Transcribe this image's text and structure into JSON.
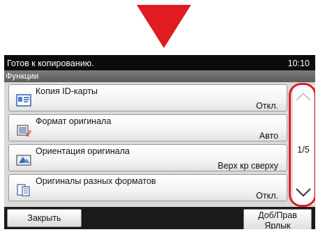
{
  "indicator": {
    "color": "#e11b22"
  },
  "status_bar": {
    "message": "Готов к копированию.",
    "time": "10:10"
  },
  "tab": {
    "label": "Функции"
  },
  "functions": [
    {
      "name": "Копия ID-карты",
      "value": "Откл.",
      "icon": "id-card-icon"
    },
    {
      "name": "Формат оригинала",
      "value": "Авто",
      "icon": "original-size-icon"
    },
    {
      "name": "Ориентация оригинала",
      "value": "Верх кр сверху",
      "icon": "orientation-icon"
    },
    {
      "name": "Оригиналы разных форматов",
      "value": "Откл.",
      "icon": "mixed-size-icon"
    }
  ],
  "scrollbar": {
    "page": "1/5",
    "up_icon": "chevron-up-icon",
    "down_icon": "chevron-down-icon"
  },
  "buttons": {
    "close": "Закрыть",
    "add_line1": "Доб/Прав",
    "add_line2": "Ярлык"
  }
}
